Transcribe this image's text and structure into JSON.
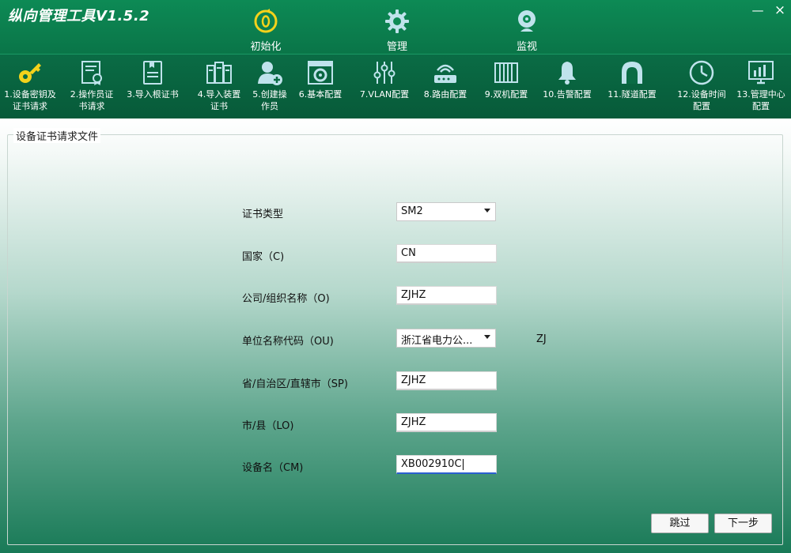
{
  "app": {
    "title": "纵向管理工具V1.5.2",
    "minimize": "—",
    "close": "×"
  },
  "modes": [
    {
      "label": "初始化",
      "icon": "init-icon"
    },
    {
      "label": "管理",
      "icon": "gear-icon"
    },
    {
      "label": "监视",
      "icon": "webcam-icon"
    }
  ],
  "toolbar": [
    {
      "line1": "1.设备密钥及",
      "line2": "证书请求",
      "icon": "key-icon"
    },
    {
      "line1": "2.操作员证",
      "line2": "书请求",
      "icon": "certificate-icon"
    },
    {
      "line1": "3.导入根证书",
      "line2": "",
      "icon": "document-icon"
    },
    {
      "line1": "4.导入装置",
      "line2": "证书",
      "icon": "server-icon"
    },
    {
      "line1": "5.创建操",
      "line2": "作员",
      "icon": "add-user-icon"
    },
    {
      "line1": "6.基本配置",
      "line2": "",
      "icon": "settings-window-icon"
    },
    {
      "line1": "7.VLAN配置",
      "line2": "",
      "icon": "sliders-icon"
    },
    {
      "line1": "8.路由配置",
      "line2": "",
      "icon": "router-icon"
    },
    {
      "line1": "9.双机配置",
      "line2": "",
      "icon": "radiator-icon"
    },
    {
      "line1": "10.告警配置",
      "line2": "",
      "icon": "bell-icon"
    },
    {
      "line1": "11.隧道配置",
      "line2": "",
      "icon": "tunnel-icon"
    },
    {
      "line1": "12.设备时间",
      "line2": "配置",
      "icon": "clock-icon"
    },
    {
      "line1": "13.管理中心",
      "line2": "配置",
      "icon": "monitor-chart-icon"
    }
  ],
  "form": {
    "group_title": "设备证书请求文件",
    "cert_type": {
      "label": "证书类型",
      "value": "SM2"
    },
    "country": {
      "label": "国家（C)",
      "value": "CN"
    },
    "org": {
      "label": "公司/组织名称（O)",
      "value": "ZJHZ"
    },
    "org_unit": {
      "label": "单位名称代码（OU)",
      "value": "浙江省电力公...",
      "code": "ZJ"
    },
    "province": {
      "label": "省/自治区/直辖市（SP)",
      "value": "ZJHZ"
    },
    "city": {
      "label": "市/县（LO)",
      "value": "ZJHZ"
    },
    "device_name": {
      "label": "设备名（CM)",
      "value": "XB002910C"
    }
  },
  "buttons": {
    "skip": "跳过",
    "next": "下一步"
  }
}
